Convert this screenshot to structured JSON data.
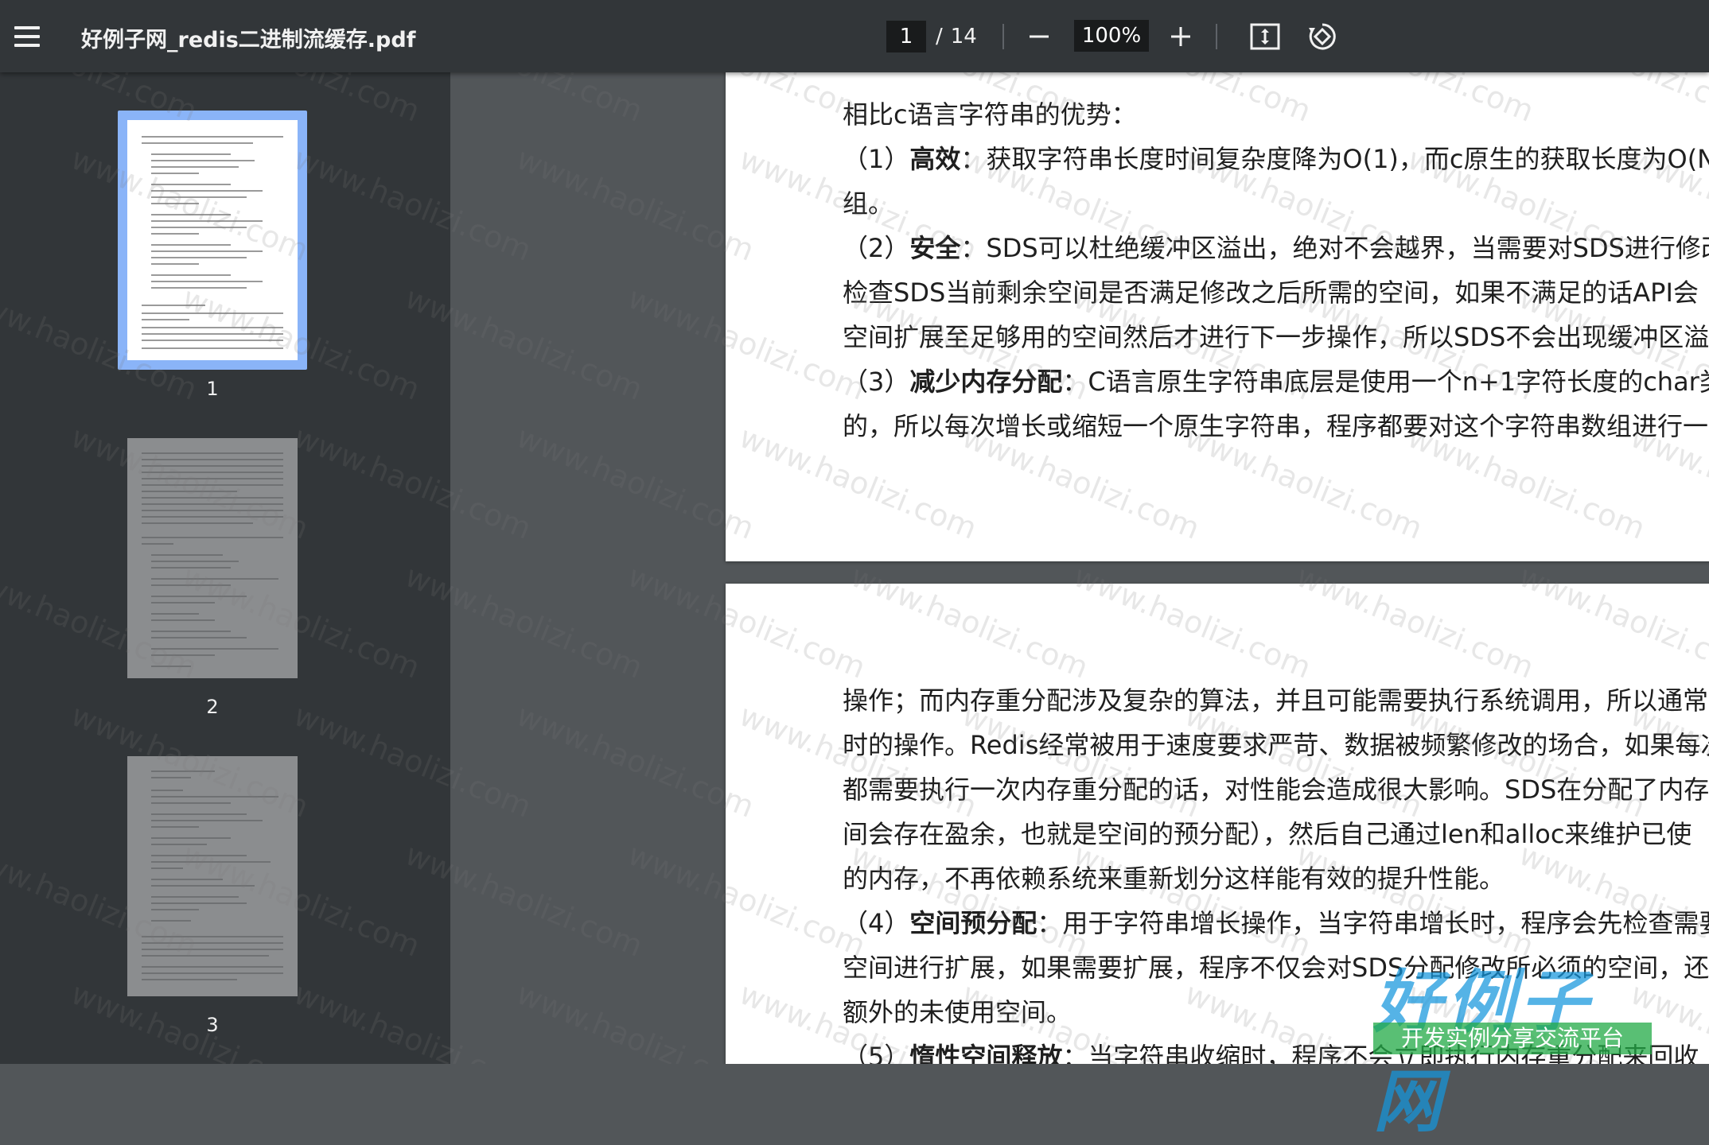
{
  "toolbar": {
    "title": "好例子网_redis二进制流缓存.pdf",
    "current_page": "1",
    "page_separator": "/",
    "total_pages": "14",
    "zoom": "100%"
  },
  "sidebar": {
    "thumbnails": [
      {
        "label": "1",
        "selected": true
      },
      {
        "label": "2",
        "selected": false
      },
      {
        "label": "3",
        "selected": false
      }
    ]
  },
  "page1": {
    "lines": [
      {
        "text": "相比c语言字符串的优势："
      },
      {
        "pre": "（1）",
        "bold": "高效",
        "text": "：获取字符串长度时间复杂度降为O(1)，而c原生的获取长度为O(N"
      },
      {
        "text": "组。"
      },
      {
        "pre": "（2）",
        "bold": "安全",
        "text": "：SDS可以杜绝缓冲区溢出，绝对不会越界，当需要对SDS进行修改"
      },
      {
        "text": "检查SDS当前剩余空间是否满足修改之后所需的空间，如果不满足的话API会"
      },
      {
        "text": "空间扩展至足够用的空间然后才进行下一步操作，所以SDS不会出现缓冲区溢"
      },
      {
        "pre": "（3）",
        "bold": "减少内存分配",
        "text": "：C语言原生字符串底层是使用一个n+1字符长度的char类"
      },
      {
        "text": "的，所以每次增长或缩短一个原生字符串，程序都要对这个字符串数组进行一"
      }
    ]
  },
  "page2": {
    "lines": [
      {
        "text": "操作；而内存重分配涉及复杂的算法，并且可能需要执行系统调用，所以通常"
      },
      {
        "text": "时的操作。Redis经常被用于速度要求严苛、数据被频繁修改的场合，如果每次"
      },
      {
        "text": "都需要执行一次内存重分配的话，对性能会造成很大影响。SDS在分配了内存"
      },
      {
        "text": "间会存在盈余，也就是空间的预分配），然后自己通过len和alloc来维护已使"
      },
      {
        "text": "的内存，不再依赖系统来重新划分这样能有效的提升性能。"
      },
      {
        "pre": "（4）",
        "bold": "空间预分配",
        "text": "：用于字符串增长操作，当字符串增长时，程序会先检查需要"
      },
      {
        "text": "空间进行扩展，如果需要扩展，程序不仅会对SDS分配修改所必须的空间，还"
      },
      {
        "text": "额外的未使用空间。"
      },
      {
        "pre": "（5）",
        "bold": "惰性空间释放",
        "text": "：当字符串收缩时，程序不会立即执行内存重分配来回收"
      }
    ]
  },
  "watermark": {
    "text": "www.haolizi.com"
  },
  "brand": {
    "logo": "好例子网",
    "tagline": "开发实例分享交流平台"
  },
  "colors": {
    "toolbar": "#323639",
    "viewer_bg": "#525659",
    "selected_thumb": "#8ab4f8"
  }
}
